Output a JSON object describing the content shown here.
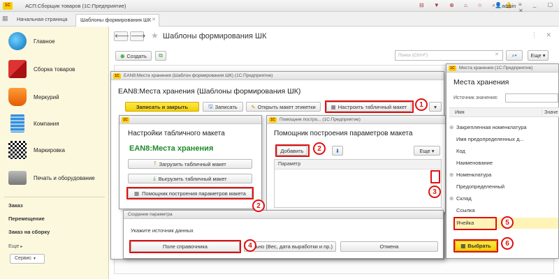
{
  "app": {
    "title": "АСП:Сборщик товаров (1С:Предприятие)",
    "user": "admin",
    "tabs": [
      "Начальная страница",
      "Шаблоны формирования ШК"
    ]
  },
  "sidebar": {
    "items": [
      {
        "label": "Главное",
        "icon": "globe-icon"
      },
      {
        "label": "Сборка товаров",
        "icon": "boxes-icon"
      },
      {
        "label": "Меркурий",
        "icon": "mercury-icon"
      },
      {
        "label": "Компания",
        "icon": "building-icon"
      },
      {
        "label": "Маркировка",
        "icon": "datamatrix-icon"
      },
      {
        "label": "Печать и оборудование",
        "icon": "printer-icon"
      }
    ],
    "links": [
      "Заказ",
      "Перемещение",
      "Заказ на сборку"
    ],
    "more": "Еще",
    "service": "Сервис"
  },
  "main": {
    "title": "Шаблоны формирования ШК",
    "create_label": "Создать",
    "search_placeholder": "Поиск (Ctrl+F)",
    "more_label": "Еще"
  },
  "ean_window": {
    "titlebar": "EAN8:Места хранения (Шаблон формирования ШК) (1С:Предприятие)",
    "heading": "EAN8:Места хранения (Шаблоны формирования ШК)",
    "save_close": "Записать и закрыть",
    "save": "Записать",
    "open_layout": "Открыть макет этикетки",
    "setup_layout": "Настроить табличный макет"
  },
  "settings_window": {
    "titlebar": "",
    "heading": "Настройки табличного макета",
    "subheading": "EAN8:Места хранения",
    "load": "Загрузить табличный макет",
    "unload": "Выгрузить табличный макет",
    "helper": "Помощник построения параметров макета"
  },
  "helper_window": {
    "titlebar": "Помощник постро... (1С:Предприятие)",
    "heading": "Помощник построения параметров макета",
    "add": "Добавить",
    "more": "Еще",
    "column": "Параметр"
  },
  "create_param_window": {
    "titlebar": "Создание параметра",
    "prompt": "Укажите источник данных",
    "field_ref": "Поле справочника",
    "additional": "лнительно (Вес, дата выработки и пр.)",
    "cancel": "Отмена"
  },
  "storage_window": {
    "titlebar": "Места хранения (1С:Предприятие)",
    "heading": "Места хранения",
    "source_label": "Источник значения:",
    "col_name": "Имя",
    "col_value": "Значе",
    "rows": [
      {
        "label": "Закрепленная номенклатура",
        "expand": true
      },
      {
        "label": "Имя предопределенных д...",
        "expand": false
      },
      {
        "label": "Код",
        "expand": false
      },
      {
        "label": "Наименование",
        "expand": false
      },
      {
        "label": "Номенклатура",
        "expand": true
      },
      {
        "label": "Предопределенный",
        "expand": false
      },
      {
        "label": "Склад",
        "expand": true
      },
      {
        "label": "Ссылка",
        "expand": false
      },
      {
        "label": "Ячейка",
        "expand": false
      }
    ],
    "select": "Выбрать"
  },
  "badges": [
    "1",
    "2",
    "2",
    "3",
    "4",
    "5",
    "6"
  ]
}
